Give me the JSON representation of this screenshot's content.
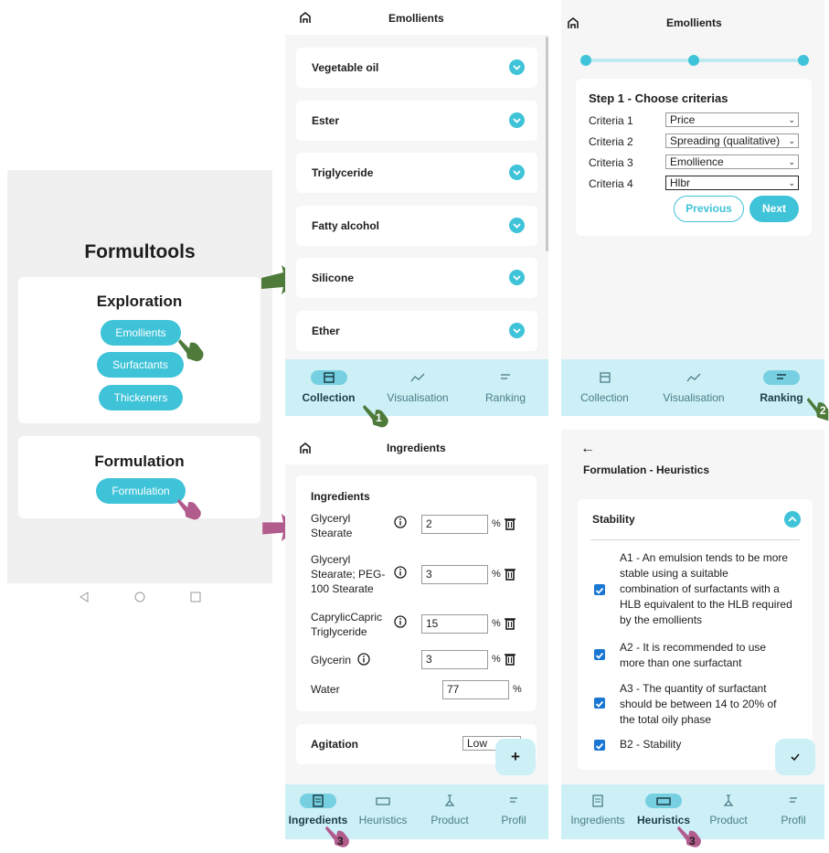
{
  "home": {
    "app_title": "Formultools",
    "exploration": {
      "heading": "Exploration",
      "buttons": [
        "Emollients",
        "Surfactants",
        "Thickeners"
      ]
    },
    "formulation": {
      "heading": "Formulation",
      "button": "Formulation"
    }
  },
  "collection_panel": {
    "title": "Emollients",
    "items": [
      "Vegetable oil",
      "Ester",
      "Triglyceride",
      "Fatty alcohol",
      "Silicone",
      "Ether"
    ],
    "nav": [
      "Collection",
      "Visualisation",
      "Ranking"
    ],
    "active_nav": "Collection"
  },
  "ranking_panel": {
    "title": "Emollients",
    "step_title": "Step 1 - Choose criterias",
    "criteria": [
      {
        "label": "Criteria 1",
        "value": "Price"
      },
      {
        "label": "Criteria 2",
        "value": "Spreading (qualitative)"
      },
      {
        "label": "Criteria 3",
        "value": "Emollience"
      },
      {
        "label": "Criteria 4",
        "value": "Hlbr"
      }
    ],
    "previous_label": "Previous",
    "next_label": "Next",
    "nav": [
      "Collection",
      "Visualisation",
      "Ranking"
    ],
    "active_nav": "Ranking",
    "stepper_progress": 0
  },
  "ingredients_panel": {
    "title": "Ingredients",
    "section": "Ingredients",
    "rows": [
      {
        "name_lines": [
          "Glyceryl",
          "Stearate"
        ],
        "value": "2",
        "unit": "%"
      },
      {
        "name_lines": [
          "Glyceryl",
          "Stearate; PEG-",
          "100 Stearate"
        ],
        "value": "3",
        "unit": "%"
      },
      {
        "name_lines": [
          "CaprylicCapric",
          "Triglyceride"
        ],
        "value": "15",
        "unit": "%"
      },
      {
        "name_lines": [
          "Glycerin"
        ],
        "value": "3",
        "unit": "%"
      }
    ],
    "water_label": "Water",
    "water_value": "77",
    "water_unit": "%",
    "agitation_label": "Agitation",
    "agitation_value": "Low",
    "plus": "+",
    "nav": [
      "Ingredients",
      "Heuristics",
      "Product",
      "Profil"
    ],
    "active_nav": "Ingredients"
  },
  "heuristics_panel": {
    "back": "←",
    "title": "Formulation - Heuristics",
    "section": "Stability",
    "rules": [
      {
        "lines": [
          "A1 - An emulsion tends to be more",
          "stable using a suitable",
          "combination of surfactants with a",
          "HLB equivalent to the HLB required",
          "by the emollients"
        ]
      },
      {
        "lines": [
          "A2 - It is recommended to use",
          "more than one surfactant"
        ]
      },
      {
        "lines": [
          "A3 - The quantity of surfactant",
          "should be between 14 to 20% of",
          "the total oily phase"
        ]
      },
      {
        "lines": [
          "B2 - Stability"
        ]
      }
    ],
    "nav": [
      "Ingredients",
      "Heuristics",
      "Product",
      "Profil"
    ],
    "active_nav": "Heuristics"
  },
  "annotations": {
    "marker_1": "1",
    "marker_2": "2",
    "marker_3a": "3",
    "marker_3b": "3"
  },
  "colors": {
    "accent": "#3fc3d8",
    "navbar": "#cdeff6",
    "arrow_green": "#4e7a3a",
    "arrow_pink": "#b25c8e",
    "checkbox": "#1976d2"
  }
}
